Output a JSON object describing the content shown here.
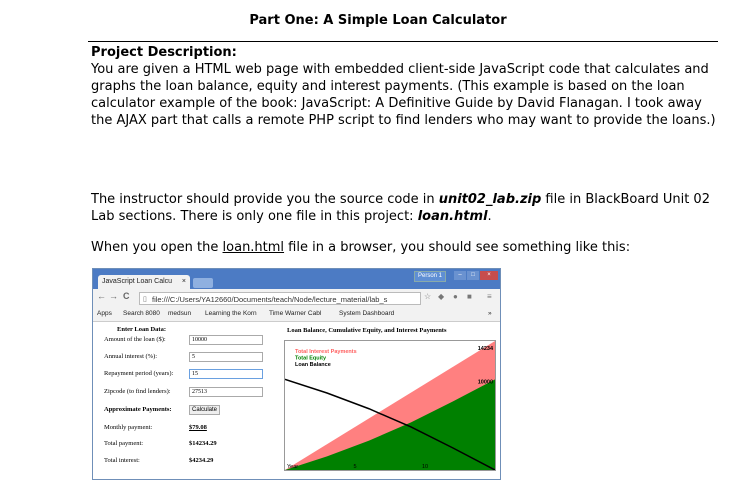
{
  "page": {
    "title": "Part One: A Simple Loan Calculator",
    "heading": "Project Description:",
    "description": "You are given a HTML web page with embedded client-side JavaScript code that calculates and graphs the loan balance, equity and interest payments. (This example is based on the loan calculator example of the book: JavaScript: A Definitive Guide by David Flanagan. I took away the AJAX part that calls a remote PHP script to find lenders who may want to provide the loans.)",
    "instr_a": "The instructor should provide you the source code in ",
    "instr_file1": "unit02_lab.zip",
    "instr_b": " file in BlackBoard Unit 02 Lab sections. There is only one file in this project: ",
    "instr_file2": "loan.html",
    "instr_c": ".",
    "open_a": "When you open the ",
    "open_link": "loan.html",
    "open_b": " file in a browser, you should see something like this:"
  },
  "browser": {
    "tab_title": "JavaScript Loan Calcu",
    "tab_close": "×",
    "person": "Person 1",
    "url": "file:///C:/Users/YA12660/Documents/teach/Node/lecture_material/lab_s",
    "bookmarks": [
      "Apps",
      "Search 8080",
      "medsun",
      "Learning the Korn",
      "Time Warner Cabl",
      "System Dashboard"
    ],
    "bookmarks_more": "»"
  },
  "form": {
    "enter_heading": "Enter Loan Data:",
    "amount_label": "Amount of the loan ($):",
    "amount_value": "10000",
    "interest_label": "Annual interest (%):",
    "interest_value": "5",
    "period_label": "Repayment period (years):",
    "period_value": "15",
    "zip_label": "Zipcode (to find lenders):",
    "zip_value": "27513",
    "approx_label": "Approximate Payments:",
    "calculate_label": "Calculate",
    "monthly_label": "Monthly payment:",
    "monthly_value": "$79.08",
    "total_label": "Total payment:",
    "total_value": "$14234.29",
    "interest_total_label": "Total interest:",
    "interest_total_value": "$4234.29"
  },
  "chart_data": {
    "type": "area",
    "title": "Loan Balance, Cumulative Equity, and Interest Payments",
    "xlabel": "Year",
    "x_ticks": [
      5,
      10
    ],
    "xlim": [
      0,
      15
    ],
    "ylim": [
      0,
      14234.29
    ],
    "value_labels": [
      "14234",
      "10000"
    ],
    "series": [
      {
        "name": "Total Interest Payments",
        "color": "#ff8080",
        "x": [
          0,
          15
        ],
        "values": [
          0,
          14234.29
        ]
      },
      {
        "name": "Total Equity",
        "color": "#008000",
        "x": [
          0,
          3,
          6,
          9,
          12,
          15
        ],
        "values": [
          0,
          1504,
          3241,
          5251,
          7573,
          10000
        ]
      },
      {
        "name": "Loan Balance",
        "color": "#000000",
        "x": [
          0,
          3,
          6,
          9,
          12,
          15
        ],
        "values": [
          10000,
          8496,
          6759,
          4749,
          2427,
          0
        ]
      }
    ]
  }
}
